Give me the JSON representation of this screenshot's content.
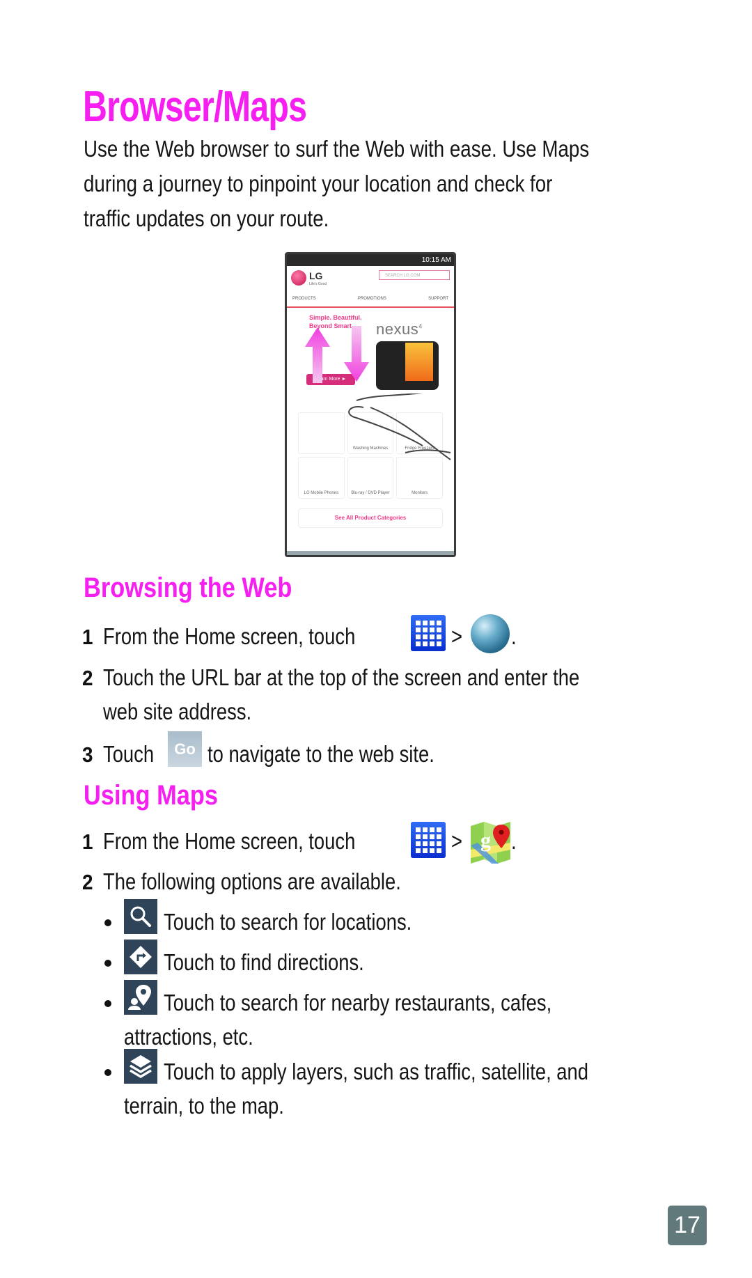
{
  "page": {
    "title": "Browser/Maps",
    "intro_lines": [
      "Use the Web browser to surf the Web with ease. Use Maps",
      "during a journey to pinpoint your location and check for",
      "traffic updates on your route."
    ],
    "page_number": "17",
    "accent_color": "#f61ef0"
  },
  "phone_screenshot": {
    "status_time": "10:15 AM",
    "brand": "LG",
    "tagline": "Life's Good",
    "search_placeholder": "SEARCH LG.COM",
    "nav": [
      "PRODUCTS",
      "PROMOTIONS",
      "SUPPORT"
    ],
    "hero_line1": "Simple. Beautiful.",
    "hero_line2": "Beyond Smart",
    "product": "nexus",
    "product_sup": "4",
    "learn_more": "Learn More ►",
    "cards": [
      "",
      "Washing Machines",
      "Fridge Freezers",
      "LG Mobile Phones",
      "Blu-ray / DVD Player",
      "Monitors"
    ],
    "see_all": "See All Product Categories"
  },
  "browsing": {
    "heading": "Browsing the Web",
    "steps": [
      {
        "num": "1",
        "text": "From the Home screen, touch",
        "sep": ">",
        "end": "."
      },
      {
        "num": "2",
        "text": "Touch the URL bar at the top of the screen and enter the",
        "cont": "web site address."
      },
      {
        "num": "3",
        "pre": "Touch",
        "button": "Go",
        "text": "to navigate to the web site."
      }
    ]
  },
  "maps": {
    "heading": "Using Maps",
    "steps": [
      {
        "num": "1",
        "text": "From the Home screen, touch",
        "sep": ">",
        "end": "."
      },
      {
        "num": "2",
        "text": "The following options are available."
      }
    ],
    "bullets": [
      {
        "icon": "search-icon",
        "text": "Touch to search for locations."
      },
      {
        "icon": "directions-icon",
        "text": "Touch to find directions."
      },
      {
        "icon": "local-places-icon",
        "text": "Touch to search for nearby restaurants, cafes,",
        "cont": "attractions, etc."
      },
      {
        "icon": "layers-icon",
        "text": "Touch to apply layers, such as traffic, satellite, and",
        "cont": "terrain, to the map."
      }
    ]
  }
}
